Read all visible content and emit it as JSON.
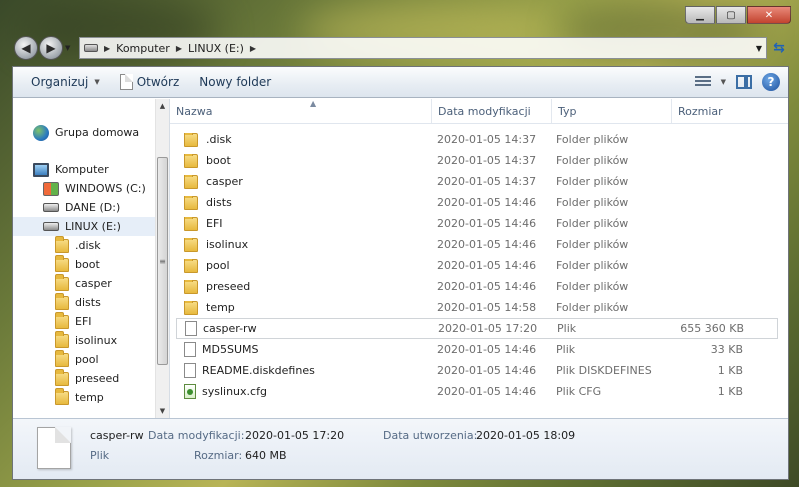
{
  "address": {
    "crumbs": [
      "Komputer",
      "LINUX (E:)"
    ]
  },
  "toolbar": {
    "organize": "Organizuj",
    "open": "Otwórz",
    "new_folder": "Nowy folder",
    "help_icon": "help-icon"
  },
  "nav": {
    "items": [
      {
        "label": "Grupa domowa",
        "icon": "homegroup-icon"
      },
      {
        "label": "Komputer",
        "icon": "computer-icon"
      },
      {
        "label": "WINDOWS (C:)",
        "icon": "windows-drive-icon"
      },
      {
        "label": "DANE (D:)",
        "icon": "drive-icon"
      },
      {
        "label": "LINUX (E:)",
        "icon": "drive-icon"
      },
      {
        "label": ".disk",
        "icon": "folder-icon"
      },
      {
        "label": "boot",
        "icon": "folder-icon"
      },
      {
        "label": "casper",
        "icon": "folder-icon"
      },
      {
        "label": "dists",
        "icon": "folder-icon"
      },
      {
        "label": "EFI",
        "icon": "folder-icon"
      },
      {
        "label": "isolinux",
        "icon": "folder-icon"
      },
      {
        "label": "pool",
        "icon": "folder-icon"
      },
      {
        "label": "preseed",
        "icon": "folder-icon"
      },
      {
        "label": "temp",
        "icon": "folder-icon"
      }
    ]
  },
  "columns": {
    "name": "Nazwa",
    "date": "Data modyfikacji",
    "type": "Typ",
    "size": "Rozmiar"
  },
  "files": [
    {
      "name": ".disk",
      "date": "2020-01-05 14:37",
      "type": "Folder plików",
      "size": "",
      "icon": "folder-icon"
    },
    {
      "name": "boot",
      "date": "2020-01-05 14:37",
      "type": "Folder plików",
      "size": "",
      "icon": "folder-icon"
    },
    {
      "name": "casper",
      "date": "2020-01-05 14:37",
      "type": "Folder plików",
      "size": "",
      "icon": "folder-icon"
    },
    {
      "name": "dists",
      "date": "2020-01-05 14:46",
      "type": "Folder plików",
      "size": "",
      "icon": "folder-icon"
    },
    {
      "name": "EFI",
      "date": "2020-01-05 14:46",
      "type": "Folder plików",
      "size": "",
      "icon": "folder-icon"
    },
    {
      "name": "isolinux",
      "date": "2020-01-05 14:46",
      "type": "Folder plików",
      "size": "",
      "icon": "folder-icon"
    },
    {
      "name": "pool",
      "date": "2020-01-05 14:46",
      "type": "Folder plików",
      "size": "",
      "icon": "folder-icon"
    },
    {
      "name": "preseed",
      "date": "2020-01-05 14:46",
      "type": "Folder plików",
      "size": "",
      "icon": "folder-icon"
    },
    {
      "name": "temp",
      "date": "2020-01-05 14:58",
      "type": "Folder plików",
      "size": "",
      "icon": "folder-icon"
    },
    {
      "name": "casper-rw",
      "date": "2020-01-05 17:20",
      "type": "Plik",
      "size": "655 360 KB",
      "icon": "file-icon"
    },
    {
      "name": "MD5SUMS",
      "date": "2020-01-05 14:46",
      "type": "Plik",
      "size": "33 KB",
      "icon": "file-icon"
    },
    {
      "name": "README.diskdefines",
      "date": "2020-01-05 14:46",
      "type": "Plik DISKDEFINES",
      "size": "1 KB",
      "icon": "file-icon"
    },
    {
      "name": "syslinux.cfg",
      "date": "2020-01-05 14:46",
      "type": "Plik CFG",
      "size": "1 KB",
      "icon": "cfg-file-icon"
    }
  ],
  "details": {
    "name": "casper-rw",
    "type": "Plik",
    "modified_label": "Data modyfikacji:",
    "modified_value": "2020-01-05 17:20",
    "size_label": "Rozmiar:",
    "size_value": "640 MB",
    "created_label": "Data utworzenia:",
    "created_value": "2020-01-05 18:09"
  }
}
